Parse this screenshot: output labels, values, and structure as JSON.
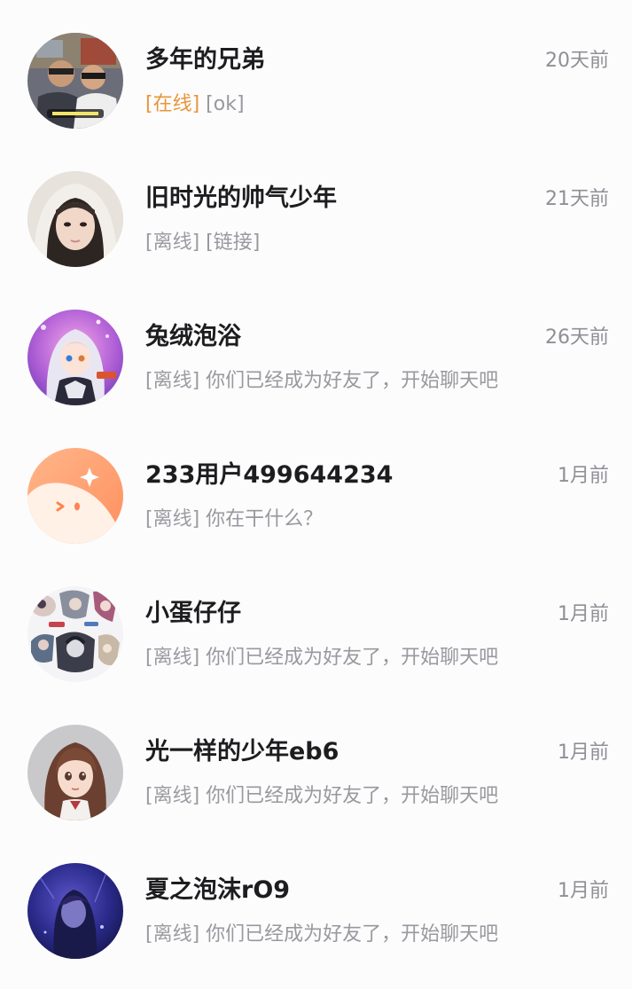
{
  "conversations": [
    {
      "name": "多年的兄弟",
      "time": "20天前",
      "status": "[在线]",
      "status_type": "online",
      "message": "[ok]",
      "avatar": "photo-two-men-avatar"
    },
    {
      "name": "旧时光的帅气少年",
      "time": "21天前",
      "status": "[离线]",
      "status_type": "offline",
      "message": "[链接]",
      "avatar": "photo-girl-hood-avatar"
    },
    {
      "name": "兔绒泡浴",
      "time": "26天前",
      "status": "[离线]",
      "status_type": "offline",
      "message": "你们已经成为好友了，开始聊天吧",
      "avatar": "anime-girl-purple-avatar"
    },
    {
      "name": "233用户499644234",
      "time": "1月前",
      "status": "[离线]",
      "status_type": "offline",
      "message": "你在干什么？",
      "avatar": "default-orange-face-avatar"
    },
    {
      "name": "小蛋仔仔",
      "time": "1月前",
      "status": "[离线]",
      "status_type": "offline",
      "message": "你们已经成为好友了，开始聊天吧",
      "avatar": "anime-collage-avatar"
    },
    {
      "name": "光一样的少年eb6",
      "time": "1月前",
      "status": "[离线]",
      "status_type": "offline",
      "message": "你们已经成为好友了，开始聊天吧",
      "avatar": "anime-girl-brown-hair-avatar"
    },
    {
      "name": "夏之泡沫rO9",
      "time": "1月前",
      "status": "[离线]",
      "status_type": "offline",
      "message": "你们已经成为好友了，开始聊天吧",
      "avatar": "dark-blue-art-avatar"
    }
  ],
  "colors": {
    "online_status": "#e8963a",
    "offline_status": "#9b9ba1",
    "name_text": "#1d1d1f",
    "time_text": "#8f8f95",
    "background": "#fcfcfd"
  }
}
